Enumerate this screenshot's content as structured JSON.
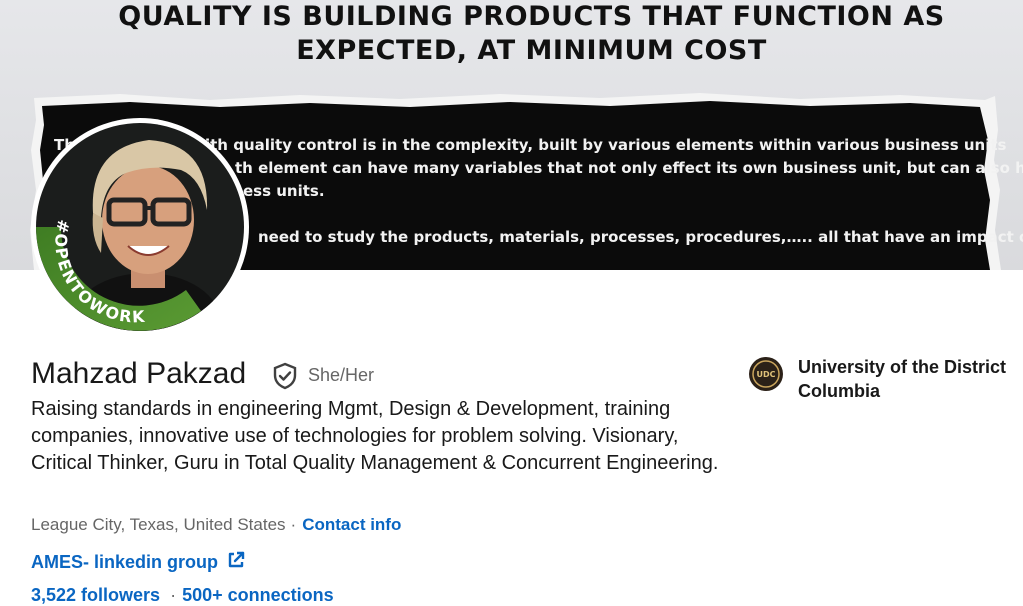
{
  "banner": {
    "headline_line1": "QUALITY IS BUILDING PRODUCTS THAT FUNCTION AS",
    "headline_line2": "EXPECTED, AT MINIMUM COST",
    "paper_lines": [
      "Th",
      "ith quality control is in the complexity, built by various elements within various business units",
      "th element can have many variables that not only effect its own business unit, but can also have",
      "ess units.",
      "need to study the products, materials, processes, procedures,….. all that have an impact on"
    ]
  },
  "avatar": {
    "badge_text": "#OPENTOWORK",
    "ring_color": "#4a8b2c"
  },
  "profile": {
    "name": "Mahzad Pakzad",
    "verified_icon": "shield-check-icon",
    "pronouns": "She/Her",
    "headline": "Raising standards in engineering Mgmt, Design & Development, training companies, innovative use of technologies for problem solving. Visionary, Critical Thinker, Guru in Total Quality Management & Concurrent Engineering.",
    "location": "League City, Texas, United States",
    "location_separator": "·",
    "contact_info_label": "Contact info",
    "website_label": "AMES- linkedin group",
    "website_icon": "external-link-icon",
    "followers": "3,522 followers",
    "network_separator": "·",
    "connections": "500+ connections"
  },
  "education": {
    "school_name": "University of the District Columbia",
    "logo_text": "UDC"
  },
  "colors": {
    "link": "#0a66c2",
    "text_primary": "#191919",
    "text_secondary": "#666666"
  }
}
